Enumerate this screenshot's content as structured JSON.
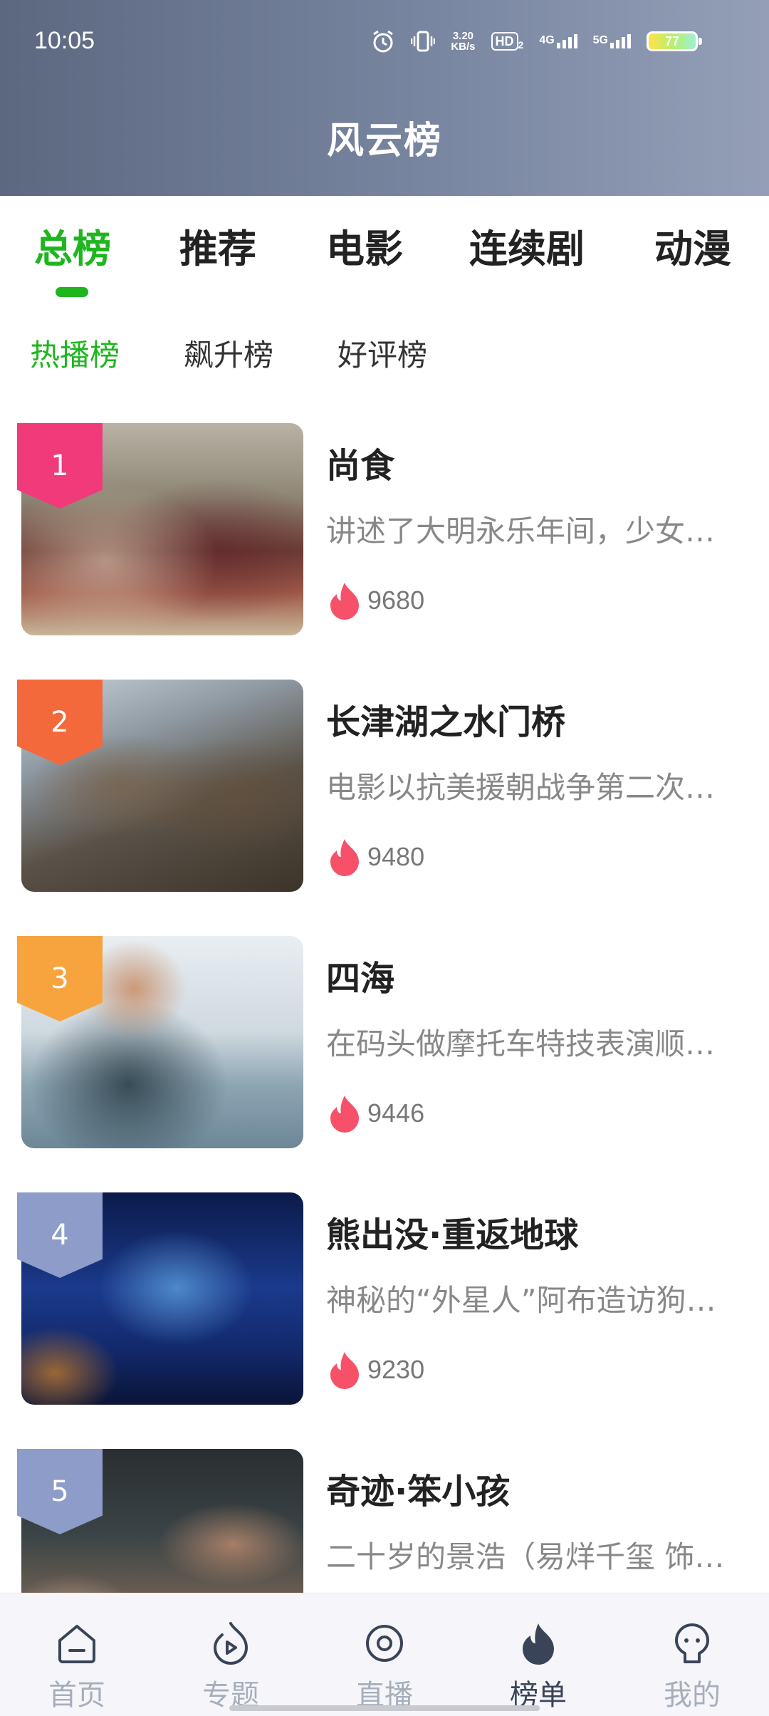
{
  "status_bar": {
    "time": "10:05",
    "net_speed_value": "3.20",
    "net_speed_unit": "KB/s",
    "hd_label": "HD",
    "hd_sub": "2",
    "net1": "4G",
    "net2": "5G",
    "battery": "77"
  },
  "header": {
    "title": "风云榜"
  },
  "main_tabs": [
    {
      "label": "总榜",
      "active": true
    },
    {
      "label": "推荐"
    },
    {
      "label": "电影"
    },
    {
      "label": "连续剧"
    },
    {
      "label": "动漫"
    }
  ],
  "sub_tabs": [
    {
      "label": "热播榜",
      "active": true
    },
    {
      "label": "飙升榜"
    },
    {
      "label": "好评榜"
    }
  ],
  "items": [
    {
      "rank": "1",
      "title": "尚食",
      "desc": "讲述了大明永乐年间，少女姚子衿",
      "heat": "9680",
      "rank_color": "#f03a7a"
    },
    {
      "rank": "2",
      "title": "长津湖之水门桥",
      "desc": "电影以抗美援朝战争第二次战役中",
      "heat": "9480",
      "rank_color": "#f3693b"
    },
    {
      "rank": "3",
      "title": "四海",
      "desc": "在码头做摩托车特技表演顺便谋生",
      "heat": "9446",
      "rank_color": "#f7a43e"
    },
    {
      "rank": "4",
      "title": "熊出没·重返地球",
      "desc": "神秘的“外星人”阿布造访狗熊岭",
      "heat": "9230",
      "rank_color": "#8d9cc9"
    },
    {
      "rank": "5",
      "title": "奇迹·笨小孩",
      "desc": "二十岁的景浩（易烊千玺 饰）独自",
      "heat": "",
      "rank_color": "#8d9cc9"
    }
  ],
  "bottom_nav": [
    {
      "label": "首页",
      "icon": "home-icon"
    },
    {
      "label": "专题",
      "icon": "play-flame-icon"
    },
    {
      "label": "直播",
      "icon": "live-icon"
    },
    {
      "label": "榜单",
      "icon": "flame-icon",
      "active": true
    },
    {
      "label": "我的",
      "icon": "profile-icon"
    }
  ]
}
